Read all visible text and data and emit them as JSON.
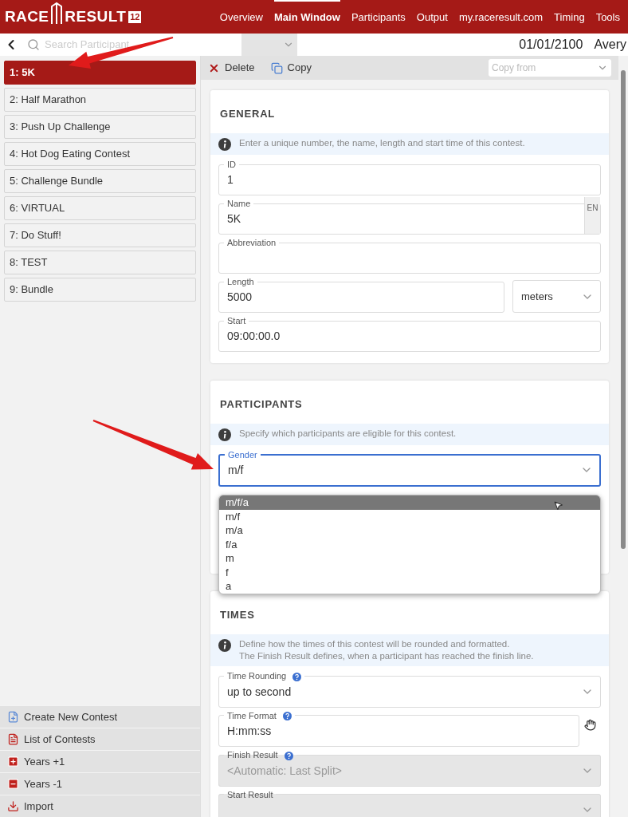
{
  "header": {
    "logo": {
      "word_1": "RACE",
      "word_2": "RESULT",
      "version": "12"
    },
    "nav": [
      {
        "label": "Overview",
        "selected": false
      },
      {
        "label": "Main Window",
        "selected": true
      },
      {
        "label": "Participants",
        "selected": false
      },
      {
        "label": "Output",
        "selected": false
      },
      {
        "label": "my.raceresult.com",
        "selected": false
      },
      {
        "label": "Timing",
        "selected": false
      },
      {
        "label": "Tools",
        "selected": false
      }
    ]
  },
  "subbar": {
    "search": {
      "placeholder": "Search Participant"
    },
    "filter_select": {
      "disabled": true
    },
    "date": "01/01/2100",
    "user": "Avery"
  },
  "sidebar": {
    "contests": [
      {
        "label": "1: 5K",
        "selected": true
      },
      {
        "label": "2: Half Marathon",
        "selected": false
      },
      {
        "label": "3: Push Up Challenge",
        "selected": false
      },
      {
        "label": "4: Hot Dog Eating Contest",
        "selected": false
      },
      {
        "label": "5: Challenge Bundle",
        "selected": false
      },
      {
        "label": "6: VIRTUAL",
        "selected": false
      },
      {
        "label": "7: Do Stuff!",
        "selected": false
      },
      {
        "label": "8: TEST",
        "selected": false
      },
      {
        "label": "9: Bundle",
        "selected": false
      }
    ],
    "actions": [
      {
        "kind": "create",
        "label": "Create New Contest"
      },
      {
        "kind": "pdf",
        "label": "List of Contests"
      },
      {
        "kind": "plus",
        "label": "Years +1"
      },
      {
        "kind": "minus",
        "label": "Years -1"
      },
      {
        "kind": "import",
        "label": "Import"
      }
    ]
  },
  "toolbar": {
    "buttons": [
      {
        "kind": "delete",
        "label": "Delete"
      },
      {
        "kind": "copy",
        "label": "Copy"
      }
    ],
    "copy_from": {
      "placeholder": "Copy from"
    }
  },
  "sections": [
    {
      "title": "GENERAL",
      "info": [
        "Enter a unique number, the name, length and start time of this contest."
      ],
      "fields": [
        {
          "kind": "text",
          "label": "ID",
          "value": "1"
        },
        {
          "kind": "text",
          "label": "Name",
          "value": "5K",
          "badge": "EN"
        },
        {
          "kind": "text",
          "label": "Abbreviation"
        },
        {
          "kind": "unit",
          "label": "Length",
          "value": "5000",
          "unit": "meters"
        },
        {
          "kind": "text",
          "label": "Start",
          "value": "09:00:00.0"
        }
      ]
    },
    {
      "title": "PARTICIPANTS",
      "info": [
        "Specify which participants are eligible for this contest."
      ],
      "fields": [
        {
          "kind": "select",
          "label": "Gender",
          "value": "m/f",
          "focused": true,
          "expanded": true,
          "options": [
            {
              "label": "m/f/a",
              "highlighted": true
            },
            {
              "label": "m/f",
              "highlighted": false
            },
            {
              "label": "m/a",
              "highlighted": false
            },
            {
              "label": "f/a",
              "highlighted": false
            },
            {
              "label": "m",
              "highlighted": false
            },
            {
              "label": "f",
              "highlighted": false
            },
            {
              "label": "a",
              "highlighted": false
            }
          ]
        }
      ]
    },
    {
      "title": "TIMES",
      "info": [
        "Define how the times of this contest will be rounded and formatted.",
        "The Finish Result defines, when a participant has reached the finish line."
      ],
      "fields": [
        {
          "kind": "select",
          "label": "Time Rounding",
          "help": true,
          "value": "up to second",
          "disabled": false
        },
        {
          "kind": "text",
          "label": "Time Format",
          "help": true,
          "value": "H:mm:ss"
        },
        {
          "kind": "select",
          "label": "Finish Result",
          "help": true,
          "value": "<Automatic: Last Split>",
          "disabled": true
        },
        {
          "kind": "select",
          "label": "Start Result",
          "help": false,
          "disabled": true
        }
      ]
    }
  ]
}
